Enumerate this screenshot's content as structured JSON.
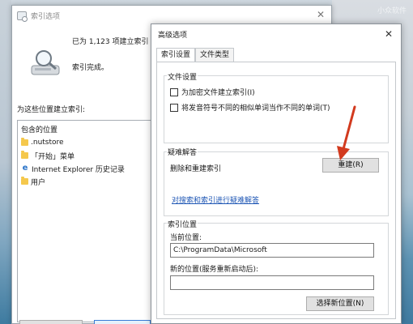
{
  "watermark": "小众软件",
  "indexing_window": {
    "title": "索引选项",
    "indexed_count": "已为 1,123 项建立索引",
    "status": "索引完成。",
    "index_for_label": "为这些位置建立索引:",
    "locations_header": "包含的位置",
    "locations": [
      {
        "label": ".nutstore",
        "icon": "folder-icon"
      },
      {
        "label": "「开始」菜单",
        "icon": "folder-icon"
      },
      {
        "label": "Internet Explorer 历史记录",
        "icon": "ie-icon"
      },
      {
        "label": "用户",
        "icon": "folder-icon"
      }
    ]
  },
  "advanced_dialog": {
    "title": "高级选项",
    "tabs": [
      "索引设置",
      "文件类型"
    ],
    "active_tab": "索引设置",
    "file_settings": {
      "title": "文件设置",
      "options": [
        {
          "label": "为加密文件建立索引(I)",
          "checked": false
        },
        {
          "label": "将发音符号不同的相似单词当作不同的单词(T)",
          "checked": false
        }
      ]
    },
    "troubleshooting": {
      "title": "疑难解答",
      "rebuild_text": "删除和重建索引",
      "rebuild_button": "重建(R)",
      "help_link": "对搜索和索引进行疑难解答"
    },
    "index_location": {
      "title": "索引位置",
      "current_label": "当前位置:",
      "current_value": "C:\\ProgramData\\Microsoft",
      "new_label": "新的位置(服务重新启动后):",
      "new_value": "",
      "select_button": "选择新位置(N)"
    }
  },
  "colors": {
    "accent": "#1f57b5",
    "arrow": "#d23a1e",
    "folder": "#f5c84c"
  }
}
